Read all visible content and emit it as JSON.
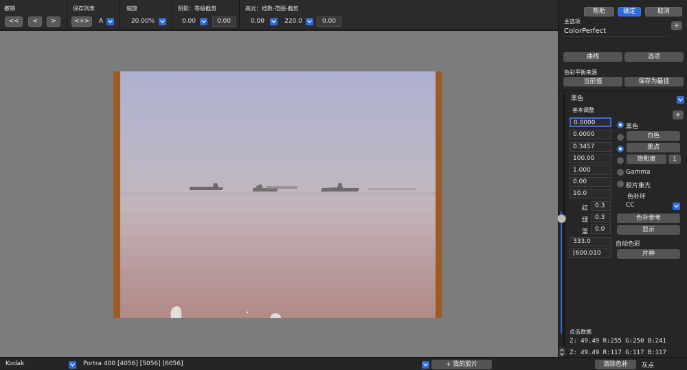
{
  "toolbar": {
    "undo": {
      "label": "撤销",
      "first": "<<",
      "prev": "<",
      "next": ">"
    },
    "savelist": {
      "label": "保存列表",
      "swap": "<+>",
      "slot": "A"
    },
    "zoom": {
      "label": "缩放",
      "value": "20.00%"
    },
    "shadow": {
      "label": "阴影：等级截剪",
      "value1": "0.00",
      "value2": "0.00"
    },
    "highlight": {
      "label": "高光：档数-范围-截剪",
      "value1": "0.00",
      "value2": "220.0",
      "value3": "0.00"
    }
  },
  "right": {
    "help": "帮助",
    "ok": "确定",
    "cancel": "取消",
    "main_label": "主选项",
    "main_value": "ColorPerfect",
    "plus": "+",
    "curve": "曲线",
    "options": "选项",
    "wb_label": "色彩平衡来源",
    "current": "当前值",
    "save_best": "保存为最佳",
    "mode_select": "黑色",
    "basic_label": "基本调整",
    "values": [
      "0.0000",
      "0.0000",
      "0.3457",
      "100.00",
      "1.000",
      "0.00",
      "10.0"
    ],
    "radio_black": "黑色",
    "white_btn": "白色",
    "blackpoint_btn": "黑点",
    "saturation_btn": "饱和度",
    "saturation_num": "1",
    "gamma": "Gamma",
    "film_overlap": "胶片重光",
    "color_ring": "色补环",
    "red_label": "红",
    "red_val": "0.3",
    "green_label": "绿",
    "green_val": "0.3",
    "blue_label": "蓝",
    "blue_val": "0.0",
    "cc_select": "CC",
    "cc_ref": "色补参考",
    "display": "显示",
    "auto_value": "333.0",
    "auto_color": "自动色彩",
    "film_value": "[600.010",
    "film_type": "片种",
    "click_data": "点击数据",
    "readout1": "Z:  49.49  R:255 G:250 B:241",
    "readout2": "Z:  49.49 R:117 G:117 B:117"
  },
  "status": {
    "brand": "Kodak",
    "film": "Portra 400 [4056] [5056] [6056]",
    "my_film": "+ 我的胶片",
    "clear_cc": "清除色补",
    "gray_point": "灰点"
  },
  "colors": {
    "accent": "#2f6bd8",
    "panel": "#262626",
    "canvas": "#7c7c7c",
    "film_border": "#9c5a24"
  },
  "icons": [
    "chevron-down-icon",
    "stepper-icon",
    "slider-handle-icon"
  ]
}
